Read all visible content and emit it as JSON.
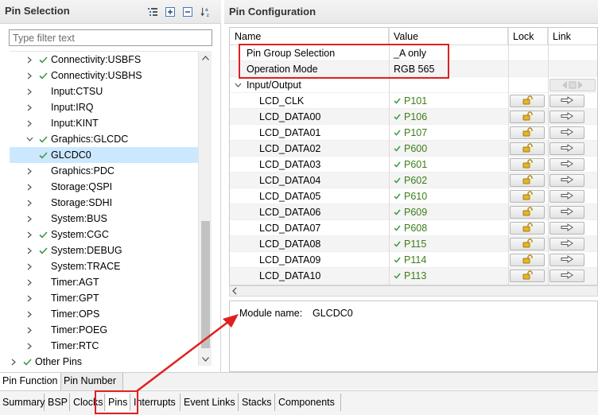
{
  "left_panel": {
    "title": "Pin Selection",
    "filter_placeholder": "Type filter text",
    "tree": [
      {
        "label": "Connectivity:USBFS",
        "checked": true,
        "expandable": true
      },
      {
        "label": "Connectivity:USBHS",
        "checked": true,
        "expandable": true
      },
      {
        "label": "Input:CTSU",
        "checked": false,
        "expandable": true
      },
      {
        "label": "Input:IRQ",
        "checked": false,
        "expandable": true
      },
      {
        "label": "Input:KINT",
        "checked": false,
        "expandable": true
      },
      {
        "label": "Graphics:GLCDC",
        "checked": true,
        "expandable": true,
        "expanded": true
      },
      {
        "label": "GLCDC0",
        "checked": true,
        "expandable": false,
        "child": true,
        "selected": true
      },
      {
        "label": "Graphics:PDC",
        "checked": false,
        "expandable": true
      },
      {
        "label": "Storage:QSPI",
        "checked": false,
        "expandable": true
      },
      {
        "label": "Storage:SDHI",
        "checked": false,
        "expandable": true
      },
      {
        "label": "System:BUS",
        "checked": false,
        "expandable": true
      },
      {
        "label": "System:CGC",
        "checked": true,
        "expandable": true
      },
      {
        "label": "System:DEBUG",
        "checked": true,
        "expandable": true
      },
      {
        "label": "System:TRACE",
        "checked": false,
        "expandable": true
      },
      {
        "label": "Timer:AGT",
        "checked": false,
        "expandable": true
      },
      {
        "label": "Timer:GPT",
        "checked": false,
        "expandable": true
      },
      {
        "label": "Timer:OPS",
        "checked": false,
        "expandable": true
      },
      {
        "label": "Timer:POEG",
        "checked": false,
        "expandable": true
      },
      {
        "label": "Timer:RTC",
        "checked": false,
        "expandable": true
      },
      {
        "label": "Other Pins",
        "checked": true,
        "expandable": true,
        "root": true
      }
    ],
    "tabs": [
      "Pin Function",
      "Pin Number"
    ]
  },
  "right_panel": {
    "title": "Pin Configuration",
    "columns": [
      "Name",
      "Value",
      "Lock",
      "Link"
    ],
    "config_rows": [
      {
        "name": "Pin Group Selection",
        "value": "_A only"
      },
      {
        "name": "Operation Mode",
        "value": "RGB 565"
      }
    ],
    "group": "Input/Output",
    "pins": [
      {
        "name": "LCD_CLK",
        "value": "P101"
      },
      {
        "name": "LCD_DATA00",
        "value": "P106"
      },
      {
        "name": "LCD_DATA01",
        "value": "P107"
      },
      {
        "name": "LCD_DATA02",
        "value": "P600"
      },
      {
        "name": "LCD_DATA03",
        "value": "P601"
      },
      {
        "name": "LCD_DATA04",
        "value": "P602"
      },
      {
        "name": "LCD_DATA05",
        "value": "P610"
      },
      {
        "name": "LCD_DATA06",
        "value": "P609"
      },
      {
        "name": "LCD_DATA07",
        "value": "P608"
      },
      {
        "name": "LCD_DATA08",
        "value": "P115"
      },
      {
        "name": "LCD_DATA09",
        "value": "P114"
      },
      {
        "name": "LCD_DATA10",
        "value": "P113"
      }
    ],
    "module_label": "Module name:",
    "module_value": "GLCDC0"
  },
  "editor_tabs": [
    "Summary",
    "BSP",
    "Clocks",
    "Pins",
    "Interrupts",
    "Event Links",
    "Stacks",
    "Components"
  ],
  "active_editor_tab": "Pins",
  "colors": {
    "accent_green": "#3c7d16",
    "annotation_red": "#e02020",
    "selection_blue": "#cce8ff"
  }
}
